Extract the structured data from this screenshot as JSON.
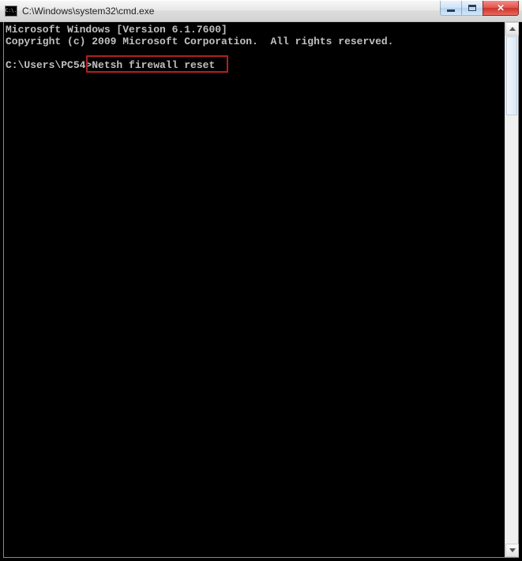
{
  "window": {
    "title": "C:\\Windows\\system32\\cmd.exe",
    "app_icon_text": "C:\\."
  },
  "terminal": {
    "line1": "Microsoft Windows [Version 6.1.7600]",
    "line2": "Copyright (c) 2009 Microsoft Corporation.  All rights reserved.",
    "blank": "",
    "prompt": "C:\\Users\\PC54>",
    "command": "Netsh firewall reset"
  }
}
